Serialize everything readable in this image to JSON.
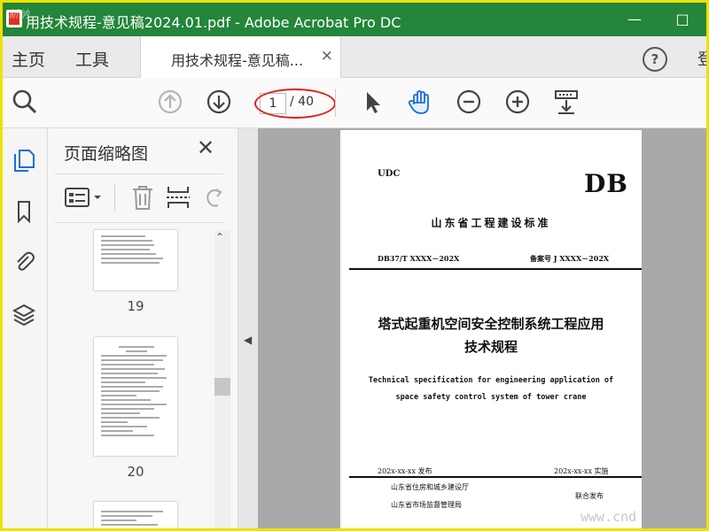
{
  "window": {
    "title": "用技术规程-意见稿2024.01.pdf - Adobe Acrobat Pro DC",
    "watermark_top_left": "新纳"
  },
  "tabbar": {
    "home": "主页",
    "tools": "工具",
    "doc_tab_label": "用技术规程-意见稿...",
    "close_glyph": "×",
    "help_glyph": "?",
    "signin": "登"
  },
  "toolbar": {
    "current_page": "1",
    "total_pages": "/ 40"
  },
  "panel": {
    "title": "页面缩略图",
    "close_glyph": "✕",
    "thumbnails": [
      {
        "page": "19"
      },
      {
        "page": "20"
      }
    ]
  },
  "document": {
    "udc": "UDC",
    "db": "DB",
    "standard_org": "山东省工程建设标准",
    "code_left": "DB37/T XXXX－202X",
    "code_right": "备案号 J XXXX－202X",
    "title_cn_line1": "塔式起重机空间安全控制系统工程应用",
    "title_cn_line2": "技术规程",
    "title_en_line1": "Technical specification for engineering application of",
    "title_en_line2": "space safety control system of tower crane",
    "issue": "202x-xx-xx  发布",
    "implement": "202x-xx-xx  实施",
    "org1": "山东省住房和城乡建设厅",
    "org2": "山东省市场监督管理局",
    "joint": "联合发布"
  },
  "watermark_bottom_right": "www.cnd",
  "colors": {
    "titlebar": "#23863a",
    "annotation_oval": "#e0201a",
    "outer_border": "#f0e000",
    "hand_tool": "#1a6fd0"
  }
}
